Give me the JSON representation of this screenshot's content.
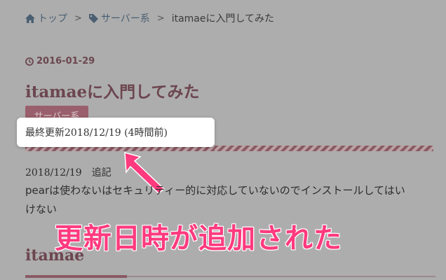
{
  "breadcrumb": {
    "home": "トップ",
    "category": "サーバー系",
    "current": "itamaeに入門してみた",
    "separator": ">"
  },
  "post": {
    "date": "2016-01-29",
    "title": "itamaeに入門してみた",
    "category_badge": "サーバー系",
    "updated": "最終更新2018/12/19 (4時間前)",
    "note_date": "2018/12/19　追記",
    "body_line1": "pearは使わないはセキュリティー的に対応していないのでインストールしてはい",
    "body_line2": "けない",
    "heading": "itamae"
  },
  "annotation": {
    "caption": "更新日時が追加された",
    "color": "#ff3a7e"
  },
  "icons": {
    "home": "home-icon",
    "tag": "tag-icon",
    "clock": "clock-icon"
  }
}
